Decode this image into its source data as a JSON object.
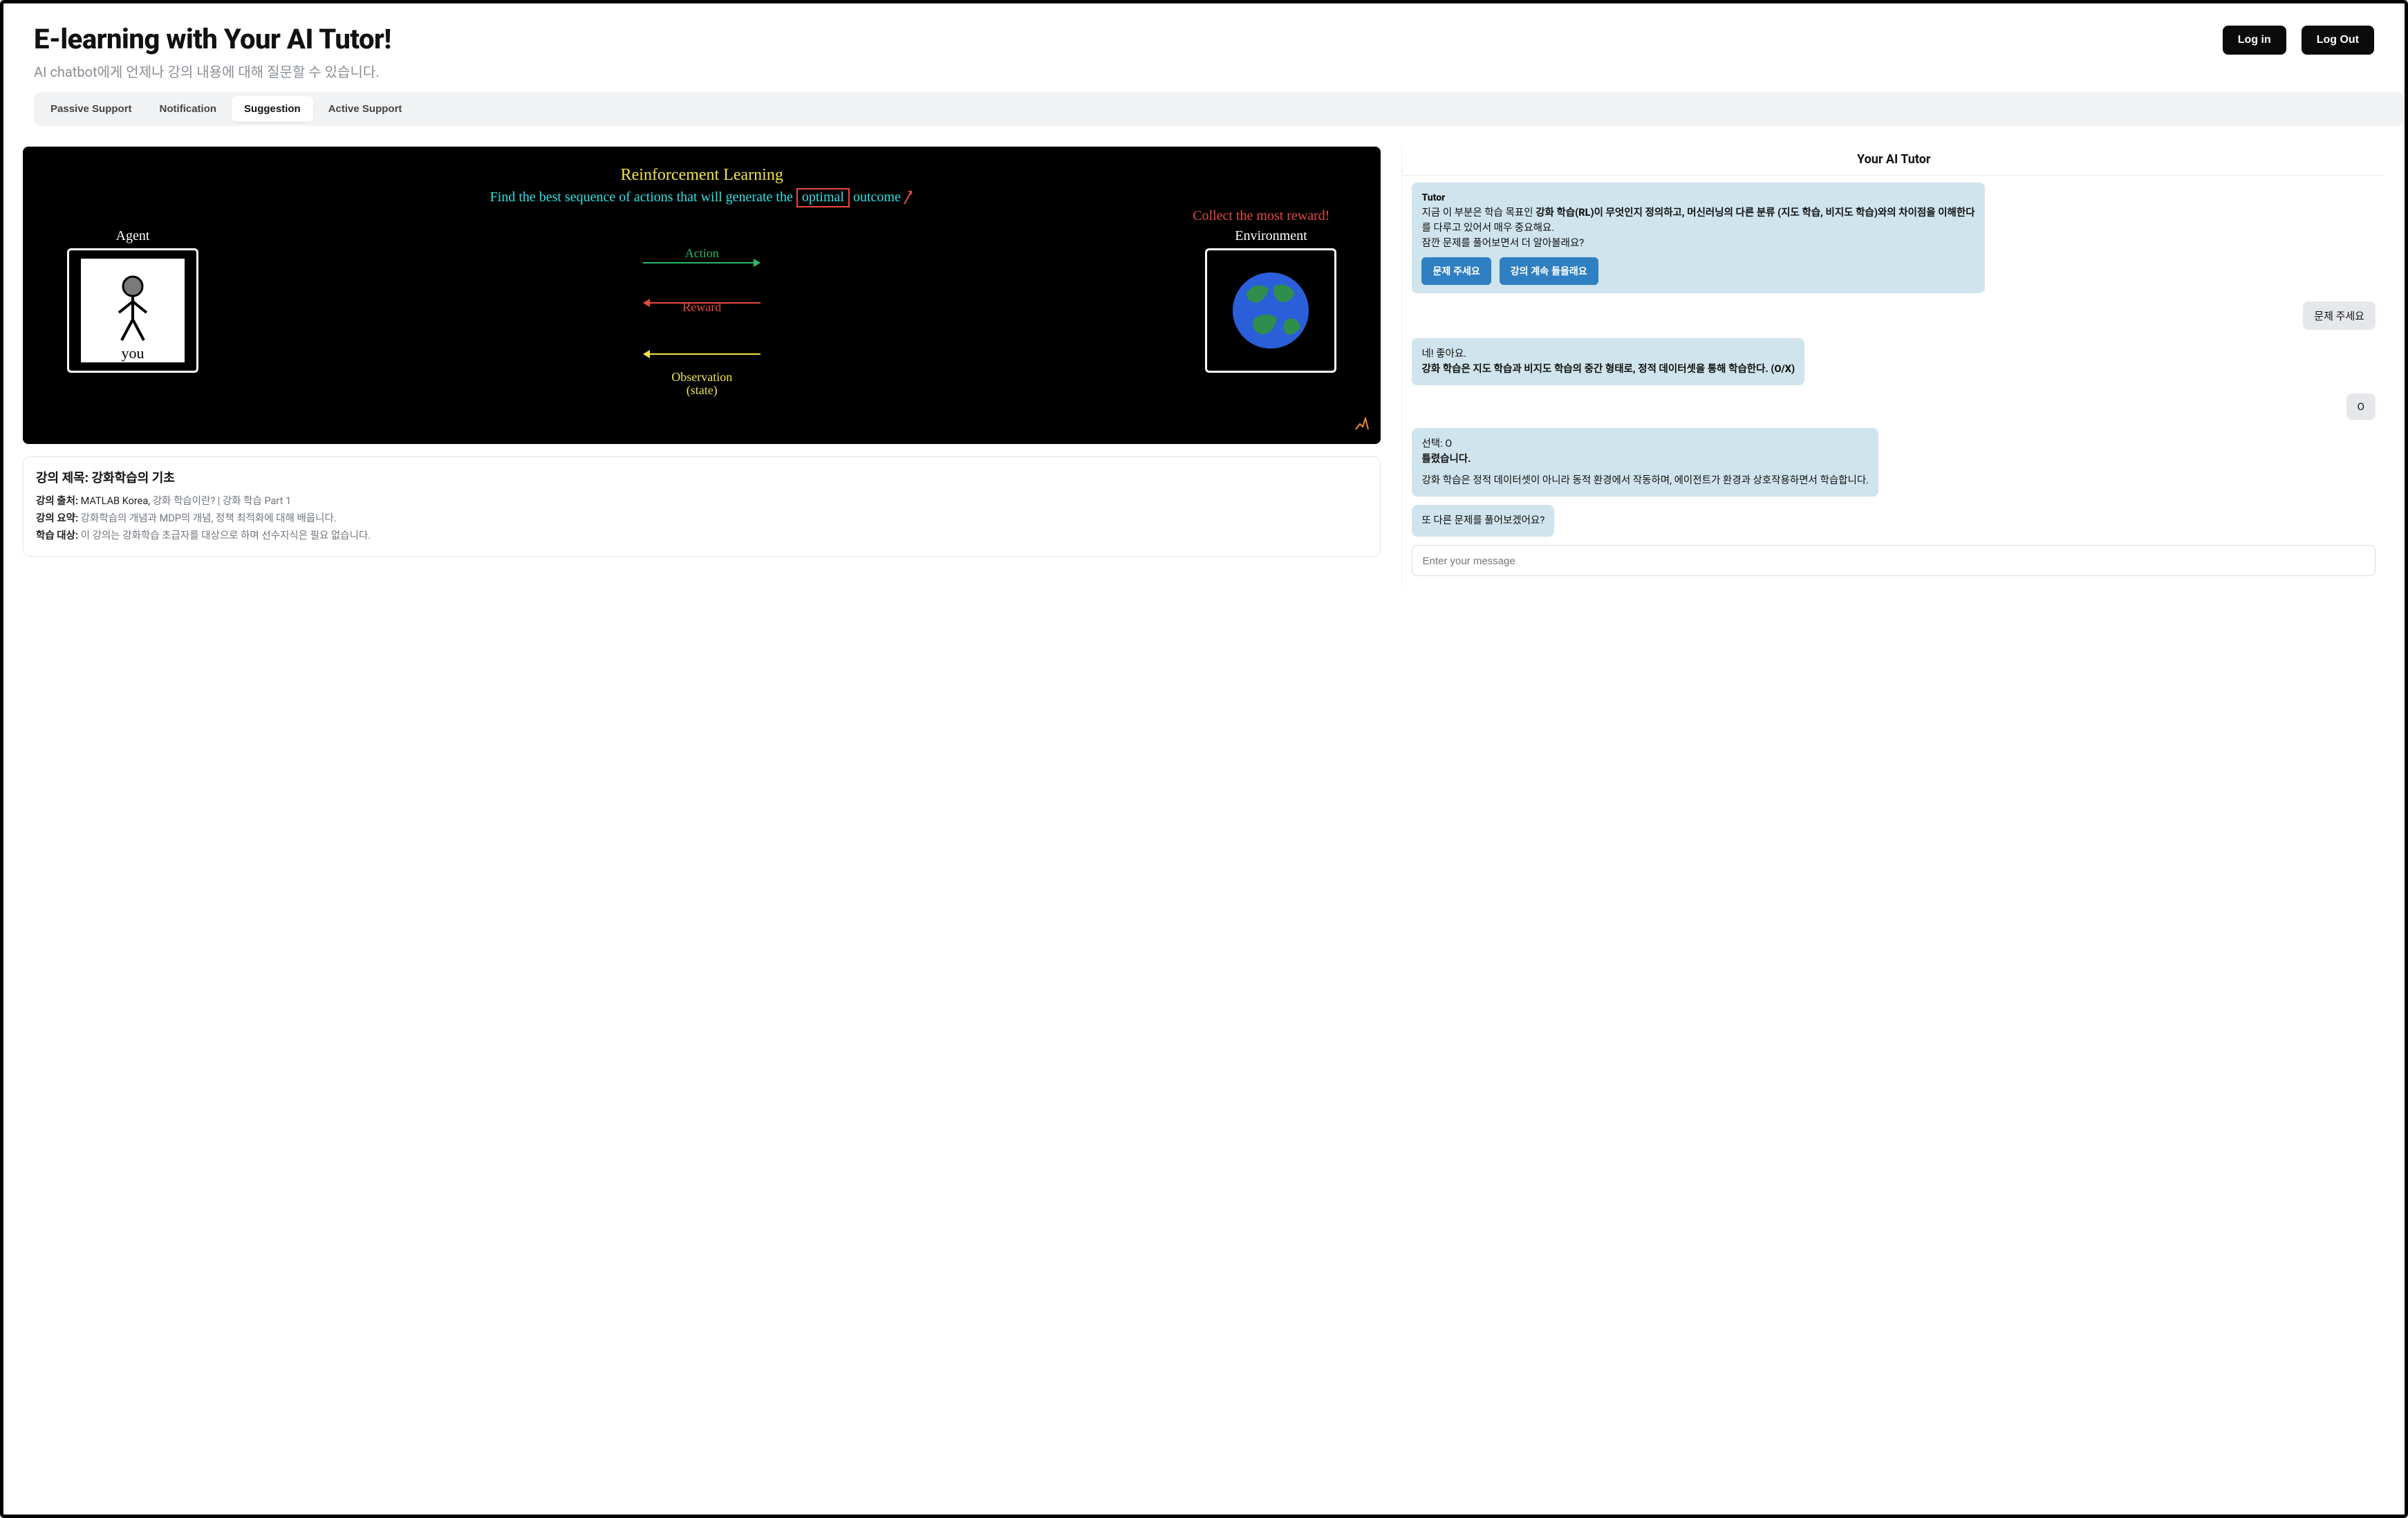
{
  "header": {
    "title": "E-learning with Your AI Tutor!",
    "subtitle": "AI chatbot에게 언제나 강의 내용에 대해 질문할 수 있습니다.",
    "login_label": "Log in",
    "logout_label": "Log Out"
  },
  "tabs": {
    "items": [
      "Passive Support",
      "Notification",
      "Suggestion",
      "Active Support"
    ],
    "active_index": 2
  },
  "slide": {
    "title": "Reinforcement Learning",
    "main_line_prefix": "Find the best sequence of actions that will generate the ",
    "main_line_boxed": "optimal",
    "main_line_suffix": " outcome",
    "red_note": "Collect the most reward!",
    "agent_label": "Agent",
    "environment_label": "Environment",
    "you_label": "you",
    "action_label": "Action",
    "reward_label": "Reward",
    "observation_label": "Observation",
    "state_label": "(state)",
    "colors": {
      "action": "#2bb86a",
      "reward": "#e74a3e",
      "observation": "#f2e24b"
    }
  },
  "lecture": {
    "title_prefix": "강의 제목: ",
    "title_value": "강화학습의 기초",
    "source_label": "강의 출처:",
    "source_value_strong": "MATLAB Korea,",
    "source_value_rest": " 강화 학습이란? | 강화 학습 Part 1",
    "summary_label": "강의 요약:",
    "summary_value": " 강화학습의 개념과 MDP의 개념, 정책 최적화에 대해 배웁니다.",
    "audience_label": "학습 대상:",
    "audience_value": " 이 강의는 강화학습 초급자를 대상으로 하며 선수지식은 필요 없습니다."
  },
  "chat": {
    "panel_title": "Your AI Tutor",
    "input_placeholder": "Enter your message",
    "messages": [
      {
        "role": "tutor",
        "sender": "Tutor",
        "line1_prefix": "지금 이 부분은 학습 목표인 ",
        "line1_bold": "강화 학습(RL)이 무엇인지 정의하고, 머신러닝의 다른 분류 (지도 학습, 비지도 학습)와의 차이점을 이해한다",
        "line2": "를 다루고 있어서 매우 중요해요.",
        "line3": "잠깐 문제를 풀어보면서 더 알아볼래요?",
        "quick_replies": [
          "문제 주세요",
          "강의 계속 들을래요"
        ]
      },
      {
        "role": "user",
        "text": "문제 주세요"
      },
      {
        "role": "tutor",
        "line1": "네! 좋아요.",
        "line2_bold": "강화 학습은 지도 학습과 비지도 학습의 중간 형태로, 정적 데이터셋을 통해 학습한다. (O/X)"
      },
      {
        "role": "user",
        "text": "O"
      },
      {
        "role": "tutor",
        "line1": "선택: O",
        "line2_bold": "틀렸습니다.",
        "line3": "강화 학습은 정적 데이터셋이 아니라 동적 환경에서 작동하며, 에이전트가 환경과 상호작용하면서 학습합니다."
      },
      {
        "role": "tutor",
        "line1": "또 다른 문제를 풀어보겠어요?"
      }
    ]
  }
}
